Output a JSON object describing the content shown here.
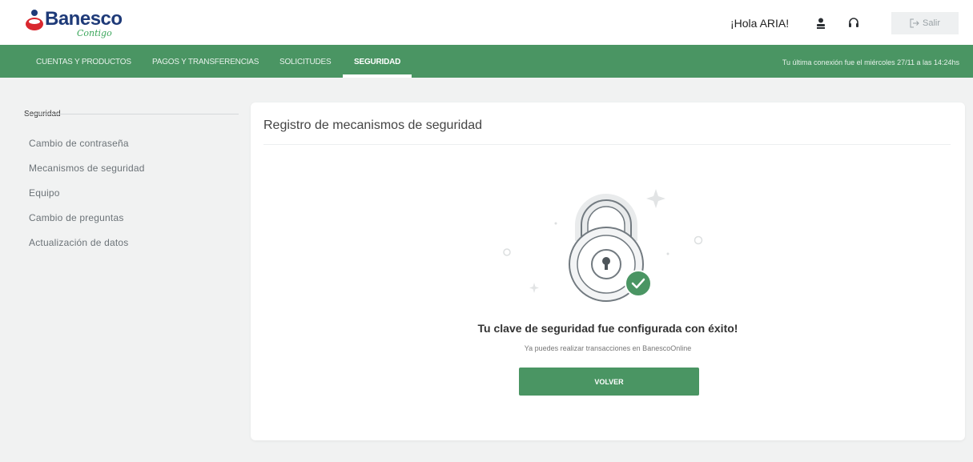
{
  "brand": {
    "name": "Banesco",
    "tagline": "Contigo",
    "colors": {
      "primary_green": "#4a9563",
      "navy": "#1e3a78",
      "red": "#d9282f"
    }
  },
  "header": {
    "greeting": "¡Hola ARIA!",
    "user_icon": "user-icon",
    "support_icon": "headset-icon",
    "logout_label": "Salir",
    "logout_icon": "logout-icon"
  },
  "nav": {
    "tabs": [
      {
        "label": "CUENTAS Y PRODUCTOS",
        "active": false
      },
      {
        "label": "PAGOS Y TRANSFERENCIAS",
        "active": false
      },
      {
        "label": "SOLICITUDES",
        "active": false
      },
      {
        "label": "SEGURIDAD",
        "active": true
      }
    ],
    "last_login": "Tu última conexión fue el miércoles 27/11 a las 14:24hs"
  },
  "sidebar": {
    "heading": "Seguridad",
    "items": [
      {
        "label": "Cambio de contraseña"
      },
      {
        "label": "Mecanismos de seguridad"
      },
      {
        "label": "Equipo"
      },
      {
        "label": "Cambio de preguntas"
      },
      {
        "label": "Actualización de datos"
      }
    ]
  },
  "card": {
    "title": "Registro de mecanismos de seguridad",
    "illustration_icon": "padlock-check-icon",
    "success_title": "Tu clave de seguridad fue configurada con éxito!",
    "success_subtitle": "Ya puedes realizar transacciones en BanescoOnline",
    "back_label": "VOLVER"
  }
}
